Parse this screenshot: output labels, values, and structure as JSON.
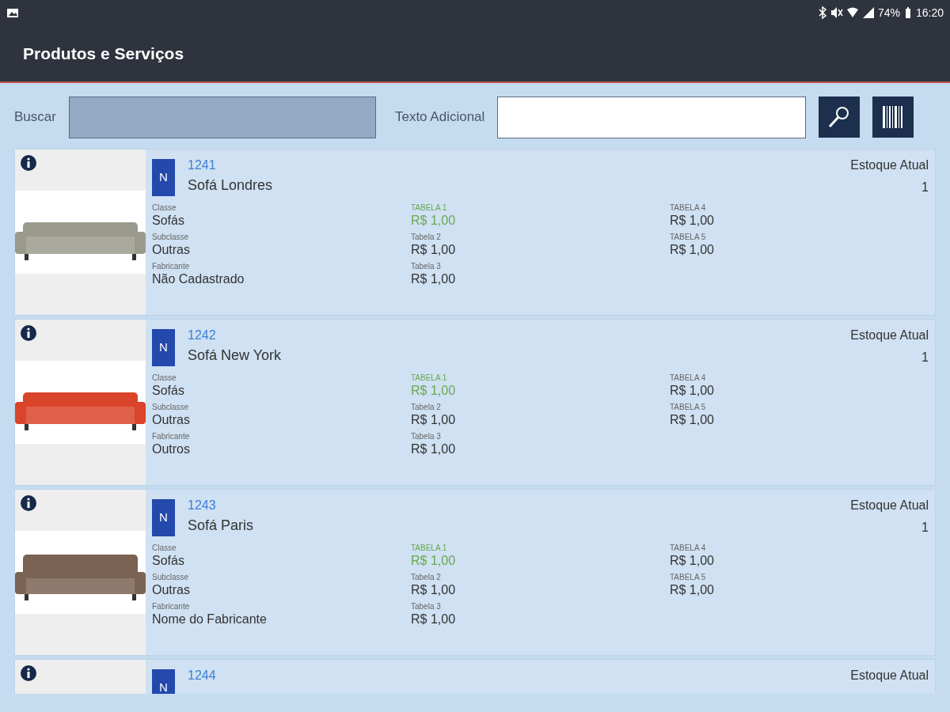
{
  "status_bar": {
    "battery": "74%",
    "time": "16:20"
  },
  "app_bar": {
    "title": "Produtos e Serviços"
  },
  "search": {
    "label": "Buscar",
    "extra_label": "Texto Adicional"
  },
  "products": [
    {
      "image": {
        "kind": "picture"
      },
      "badge": "N",
      "code": "1241",
      "name": "Sofá Londres",
      "stock_label": "Estoque Atual",
      "stock": "1",
      "fields": [
        {
          "label": "Classe",
          "value": "Sofás"
        },
        {
          "label": "Subclasse",
          "value": "Outras"
        },
        {
          "label": "Fabricante",
          "value": "Não Cadastrado"
        }
      ],
      "prices": [
        {
          "label": "TABELA 1",
          "value": "R$ 1,00",
          "highlight": true
        },
        {
          "label": "Tabela 2",
          "value": "R$ 1,00",
          "highlight": false
        },
        {
          "label": "Tabela 3",
          "value": "R$ 1,00",
          "highlight": false
        },
        {
          "label": "TABELA 4",
          "value": "R$ 1,00",
          "highlight": false
        },
        {
          "label": "TABELA 5",
          "value": "R$ 1,00",
          "highlight": false
        }
      ]
    },
    {
      "image": {
        "kind": "picture"
      },
      "badge": "N",
      "code": "1242",
      "name": "Sofá New York",
      "stock_label": "Estoque Atual",
      "stock": "1",
      "fields": [
        {
          "label": "Classe",
          "value": "Sofás"
        },
        {
          "label": "Subclasse",
          "value": "Outras"
        },
        {
          "label": "Fabricante",
          "value": "Outros"
        }
      ],
      "prices": [
        {
          "label": "TABELA 1",
          "value": "R$ 1,00",
          "highlight": true
        },
        {
          "label": "Tabela 2",
          "value": "R$ 1,00",
          "highlight": false
        },
        {
          "label": "Tabela 3",
          "value": "R$ 1,00",
          "highlight": false
        },
        {
          "label": "TABELA 4",
          "value": "R$ 1,00",
          "highlight": false
        },
        {
          "label": "TABELA 5",
          "value": "R$ 1,00",
          "highlight": false
        }
      ]
    },
    {
      "image": {
        "kind": "picture"
      },
      "badge": "N",
      "code": "1243",
      "name": "Sofá Paris",
      "stock_label": "Estoque Atual",
      "stock": "1",
      "fields": [
        {
          "label": "Classe",
          "value": "Sofás"
        },
        {
          "label": "Subclasse",
          "value": "Outras"
        },
        {
          "label": "Fabricante",
          "value": "Nome do Fabricante"
        }
      ],
      "prices": [
        {
          "label": "TABELA 1",
          "value": "R$ 1,00",
          "highlight": true
        },
        {
          "label": "Tabela 2",
          "value": "R$ 1,00",
          "highlight": false
        },
        {
          "label": "Tabela 3",
          "value": "R$ 1,00",
          "highlight": false
        },
        {
          "label": "TABELA 4",
          "value": "R$ 1,00",
          "highlight": false
        },
        {
          "label": "TABELA 5",
          "value": "R$ 1,00",
          "highlight": false
        }
      ]
    },
    {
      "badge": "N",
      "code": "1244",
      "stock_label": "Estoque Atual"
    }
  ]
}
